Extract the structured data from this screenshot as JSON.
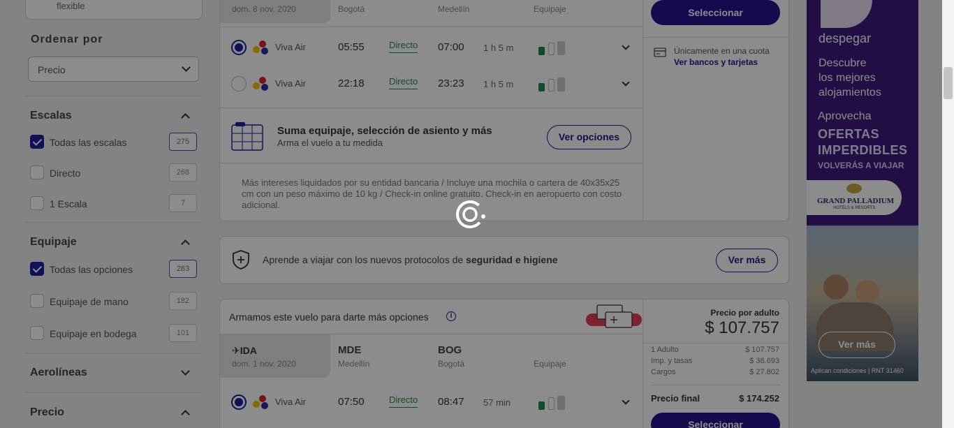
{
  "filters": {
    "flex_label": "flexible",
    "sort_title": "Ordenar por",
    "sort_value": "Precio",
    "stops": {
      "title": "Escalas",
      "options": [
        {
          "label": "Todas las escalas",
          "count": "275",
          "checked": true
        },
        {
          "label": "Directo",
          "count": "268",
          "checked": false
        },
        {
          "label": "1 Escala",
          "count": "7",
          "checked": false
        }
      ]
    },
    "baggage": {
      "title": "Equipaje",
      "options": [
        {
          "label": "Todas las opciones",
          "count": "283",
          "checked": true
        },
        {
          "label": "Equipaje de mano",
          "count": "182",
          "checked": false
        },
        {
          "label": "Equipaje en bodega",
          "count": "101",
          "checked": false
        }
      ]
    },
    "airlines_title": "Aerolíneas",
    "price_title": "Precio"
  },
  "result1": {
    "date": "dom. 8 nov. 2020",
    "origin_city": "Bogotá",
    "dest_city": "Medellín",
    "baggage_col": "Equipaje",
    "select_label": "Seleccionar",
    "installments_text": "Únicamente en una cuota",
    "banks_link": "Ver bancos y tarjetas",
    "flights": [
      {
        "airline": "Viva Air",
        "dep": "05:55",
        "type": "Directo",
        "arr": "07:00",
        "dur": "1 h 5 m",
        "selected": true
      },
      {
        "airline": "Viva Air",
        "dep": "22:18",
        "type": "Directo",
        "arr": "23:23",
        "dur": "1 h 5 m",
        "selected": false
      }
    ],
    "upsell_title": "Suma equipaje, selección de asiento y más",
    "upsell_sub": "Arma el vuelo a tu medida",
    "upsell_button": "Ver opciones",
    "note": "Más intereses liquidados por su entidad bancaria / Incluye una mochila o cartera de 40x35x25 cm con un peso máximo de 10 kg / Check-in online gratuito. Check-in en aeropuerto con costo adicional."
  },
  "safety": {
    "text_plain": "Aprende a viajar con los nuevos protocolos de ",
    "text_bold": "seguridad e higiene",
    "button": "Ver más"
  },
  "result2": {
    "header": "Armamos este vuelo para darte más opciones",
    "leg_label": "IDA",
    "date": "dom. 1 nov. 2020",
    "origin_code": "MDE",
    "origin_city": "Medellín",
    "dest_code": "BOG",
    "dest_city": "Bogotá",
    "baggage_col": "Equipaje",
    "flight": {
      "airline": "Viva Air",
      "dep": "07:50",
      "type": "Directo",
      "arr": "08:47",
      "dur": "57 min",
      "selected": true
    },
    "price_label": "Precio por adulto",
    "price": "$ 107.757",
    "breakdown": [
      {
        "label": "1 Adulto",
        "value": "$ 107.757"
      },
      {
        "label": "Imp. y tasas",
        "value": "$ 38.693"
      },
      {
        "label": "Cargos",
        "value": "$ 27.802"
      }
    ],
    "final_label": "Precio final",
    "final_value": "$ 174.252",
    "select_label": "Seleccionar"
  },
  "ad": {
    "brand": "despegar",
    "line1": "Descubre",
    "line2": "los mejores",
    "line3": "alojamientos",
    "promo1": "Aprovecha",
    "promo2": "OFERTAS",
    "promo3": "IMPERDIBLES",
    "promo4": "VOLVERÁS A VIAJAR",
    "partner_name": "GRAND PALLADIUM",
    "partner_sub": "HOTELS & RESORTS",
    "button": "Ver más",
    "disclaimer": "Aplican condiciones | RNT 31460"
  },
  "colors": {
    "primary": "#23148c",
    "direct_green": "#1b8c4c",
    "ad_purple": "#3b1a7e"
  },
  "icons": [
    "chevron-down-icon",
    "chevron-up-icon",
    "check-icon",
    "airline-logo-icon",
    "baggage-icon",
    "credit-card-icon",
    "seat-map-icon",
    "shield-plus-icon",
    "plane-icon",
    "info-icon",
    "loading-spinner-icon"
  ]
}
